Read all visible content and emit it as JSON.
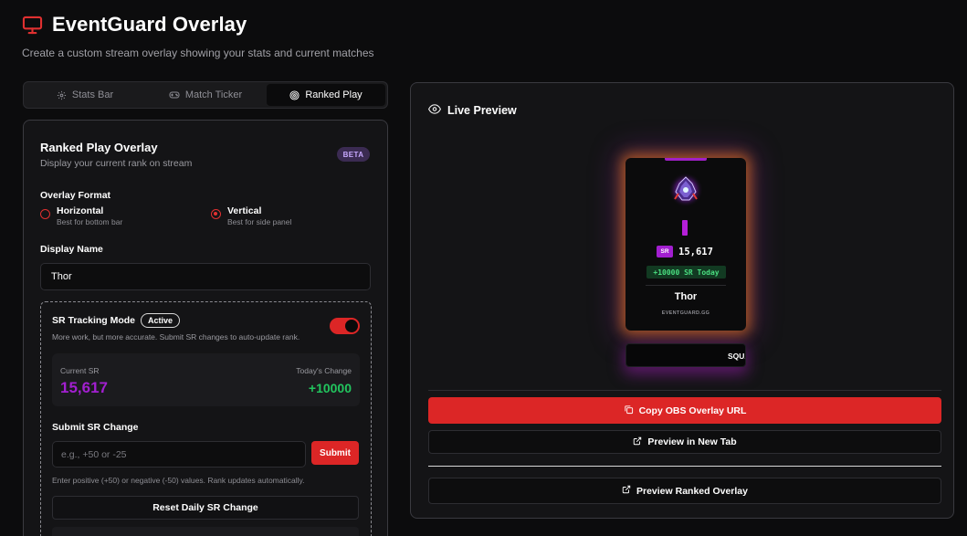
{
  "header": {
    "title": "EventGuard Overlay",
    "subtitle": "Create a custom stream overlay showing your stats and current matches"
  },
  "tabs": [
    {
      "label": "Stats Bar",
      "icon": "gear-icon"
    },
    {
      "label": "Match Ticker",
      "icon": "gamepad-icon"
    },
    {
      "label": "Ranked Play",
      "icon": "target-icon",
      "active": true
    }
  ],
  "ranked": {
    "title": "Ranked Play Overlay",
    "subtitle": "Display your current rank on stream",
    "badge": "BETA",
    "format_label": "Overlay Format",
    "formats": [
      {
        "label": "Horizontal",
        "hint": "Best for bottom bar",
        "selected": false
      },
      {
        "label": "Vertical",
        "hint": "Best for side panel",
        "selected": true
      }
    ],
    "name_label": "Display Name",
    "name_value": "Thor",
    "sr": {
      "title": "SR Tracking Mode",
      "status": "Active",
      "desc": "More work, but more accurate. Submit SR changes to auto-update rank.",
      "enabled": true,
      "current_label": "Current SR",
      "current_value": "15,617",
      "change_label": "Today's Change",
      "change_value": "+10000",
      "submit_label": "Submit SR Change",
      "input_placeholder": "e.g., +50 or -25",
      "submit_btn": "Submit",
      "hint": "Enter positive (+50) or negative (-50) values. Rank updates automatically.",
      "reset_btn": "Reset Daily SR Change"
    }
  },
  "preview": {
    "title": "Live Preview",
    "card": {
      "sr_badge": "SR",
      "sr_value": "15,617",
      "today": "+10000 SR Today",
      "name": "Thor",
      "site": "EVENTGUARD.GG"
    },
    "squad": "SQUAD:",
    "copy_btn": "Copy OBS Overlay URL",
    "new_tab_btn": "Preview in New Tab",
    "ranked_btn": "Preview Ranked Overlay"
  },
  "colors": {
    "accent": "#dc2626",
    "sr_purple": "#a21fd0",
    "positive": "#22c55e"
  }
}
